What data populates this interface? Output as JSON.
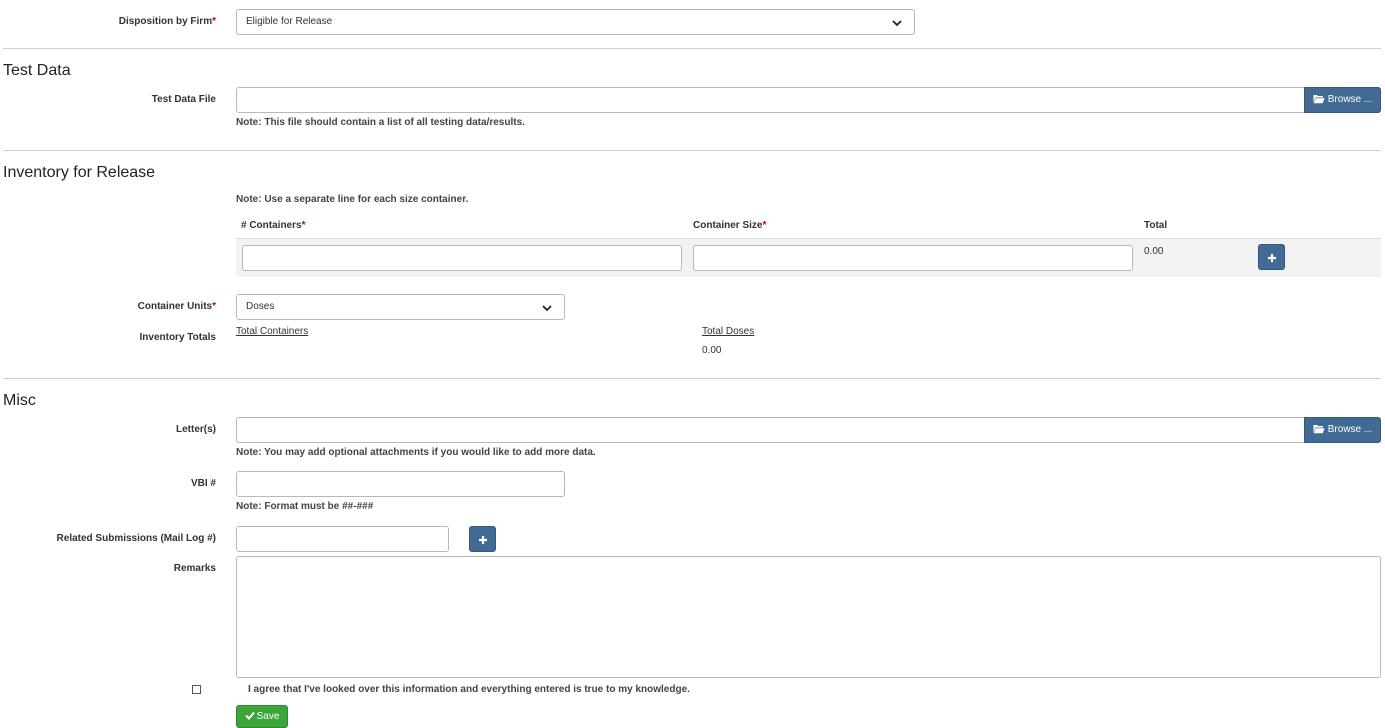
{
  "disposition": {
    "label": "Disposition by Firm",
    "required_mark": "*",
    "selected": "Eligible for Release"
  },
  "test_data": {
    "section_title": "Test Data",
    "file_label": "Test Data File",
    "browse_label": "Browse ...",
    "note": "Note: This file should contain a list of all testing data/results."
  },
  "inventory": {
    "section_title": "Inventory for Release",
    "note": "Note: Use a separate line for each size container.",
    "columns": {
      "containers": "# Containers",
      "container_size": "Container Size",
      "total": "Total"
    },
    "required_mark": "*",
    "row_total": "0.00",
    "units_label": "Container Units",
    "units_selected": "Doses",
    "totals_label": "Inventory Totals",
    "total_containers_label": "Total Containers",
    "total_doses_label": "Total Doses",
    "total_doses_value": "0.00"
  },
  "misc": {
    "section_title": "Misc",
    "letters_label": "Letter(s)",
    "browse_label": "Browse ...",
    "letters_note": "Note: You may add optional attachments if you would like to add more data.",
    "vbi_label": "VBI #",
    "vbi_note": "Note: Format must be ##-###",
    "related_label": "Related Submissions (Mail Log #)",
    "remarks_label": "Remarks"
  },
  "agreement": {
    "text": "I agree that I've looked over this information and everything entered is true to my knowledge."
  },
  "actions": {
    "save_label": "Save"
  },
  "colors": {
    "primary_button": "#416a95",
    "save_button": "#3aa63a",
    "required": "#cc0000"
  }
}
